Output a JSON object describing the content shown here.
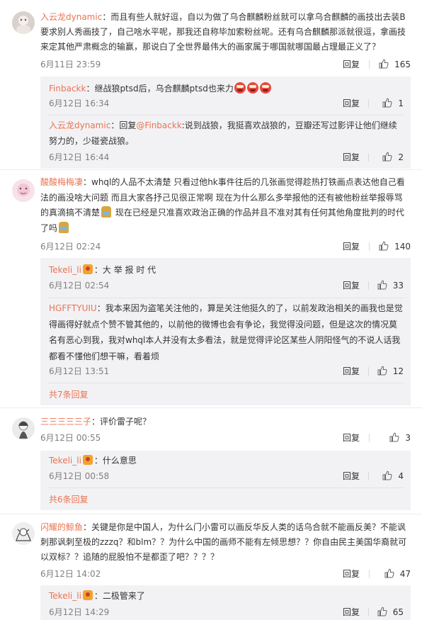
{
  "comments": [
    {
      "user": "入云龙dynamic",
      "text": "：而且有些人就好逗，自以为做了乌合麒麟粉丝就可以拿乌合麒麟的画技出去装B要求别人秀画技了，自己啥水平呢，那我还自称毕加索粉丝呢。还有乌合麒麟那派就很逗，拿画技来定其他严肃概念的输赢，那说白了全世界最伟大的画家属于哪国就哪国最占理最正义了？",
      "time": "6月11日 23:59",
      "reply": "回复",
      "likes": "165",
      "replies": [
        {
          "user": "Finbackk",
          "text": "：继战狼ptsd后，乌合麒麟ptsd也来力",
          "time": "6月12日 16:34",
          "reply": "回复",
          "likes": "1"
        },
        {
          "user": "入云龙dynamic",
          "text": "：回复",
          "mention": "@Finbackk",
          "text2": ":说到战狼，我挺喜欢战狼的，豆瓣还写过影评让他们继续努力的，少碰瓷战狼。",
          "time": "6月12日 16:44",
          "reply": "回复",
          "likes": "2"
        }
      ]
    },
    {
      "user": "酸酸梅梅凄",
      "text": "：whql的人品不太清楚 只看过他hk事件往后的几张画觉得趁热打铁画点表达他自己看法的画没啥大问题 而且大家各抒己见很正常啊 现在为什么那么多举报他的还有被他粉丝举报辱骂的真滴搞不清楚",
      "text2": " 现在已经是只准喜欢政治正确的作品并且不准对其有任何其他角度批判的时代了吗",
      "time": "6月12日 02:24",
      "reply": "回复",
      "likes": "140",
      "replies": [
        {
          "user": "Tekeli_li",
          "text": "：大 举 报 时 代",
          "time": "6月12日 02:54",
          "reply": "回复",
          "likes": "33"
        },
        {
          "user": "HGFFTYUIU",
          "text": "：我本来因为盗笔关注他的，算是关注他挺久的了，以前发政治相关的画我也是觉得画得好就点个赞不管其他的，以前他的微博也会有争论，我觉得没问题，但是这次的情况莫名有恶心到我，我对whql本人并没有太多看法，就是觉得评论区某些人阴阳怪气的不说人话我都看不懂他们想干嘛，看着烦",
          "time": "6月12日 13:51",
          "reply": "回复",
          "likes": "12"
        }
      ],
      "more": "共7条回复"
    },
    {
      "user": "三三三三三子",
      "text": "：评价雷子呢？",
      "time": "6月12日 00:55",
      "reply": "回复",
      "likes": "3",
      "replies": [
        {
          "user": "Tekeli_li",
          "text": "：什么意思",
          "time": "6月12日 00:58",
          "reply": "回复",
          "likes": "4"
        }
      ],
      "more": "共6条回复"
    },
    {
      "user": "闪耀的鲸鱼",
      "text": "：关键是你是中国人，为什么门小雷可以画反华反人类的话乌合就不能画反美？不能讽刺那讽刺至极的zzzq？和blm？？为什么中国的画师不能有左倾思想？？你自由民主美国华裔就可以双标？？追随的屁股怕不是都歪了吧？？？？",
      "time": "6月12日 14:02",
      "reply": "回复",
      "likes": "47",
      "replies": [
        {
          "user": "Tekeli_li",
          "text": "：二极管来了",
          "time": "6月12日 14:29",
          "reply": "回复",
          "likes": "65"
        }
      ]
    }
  ],
  "colors": {
    "username": "#eb7350",
    "subbox_bg": "#f2f2f5",
    "meta": "#808080"
  }
}
